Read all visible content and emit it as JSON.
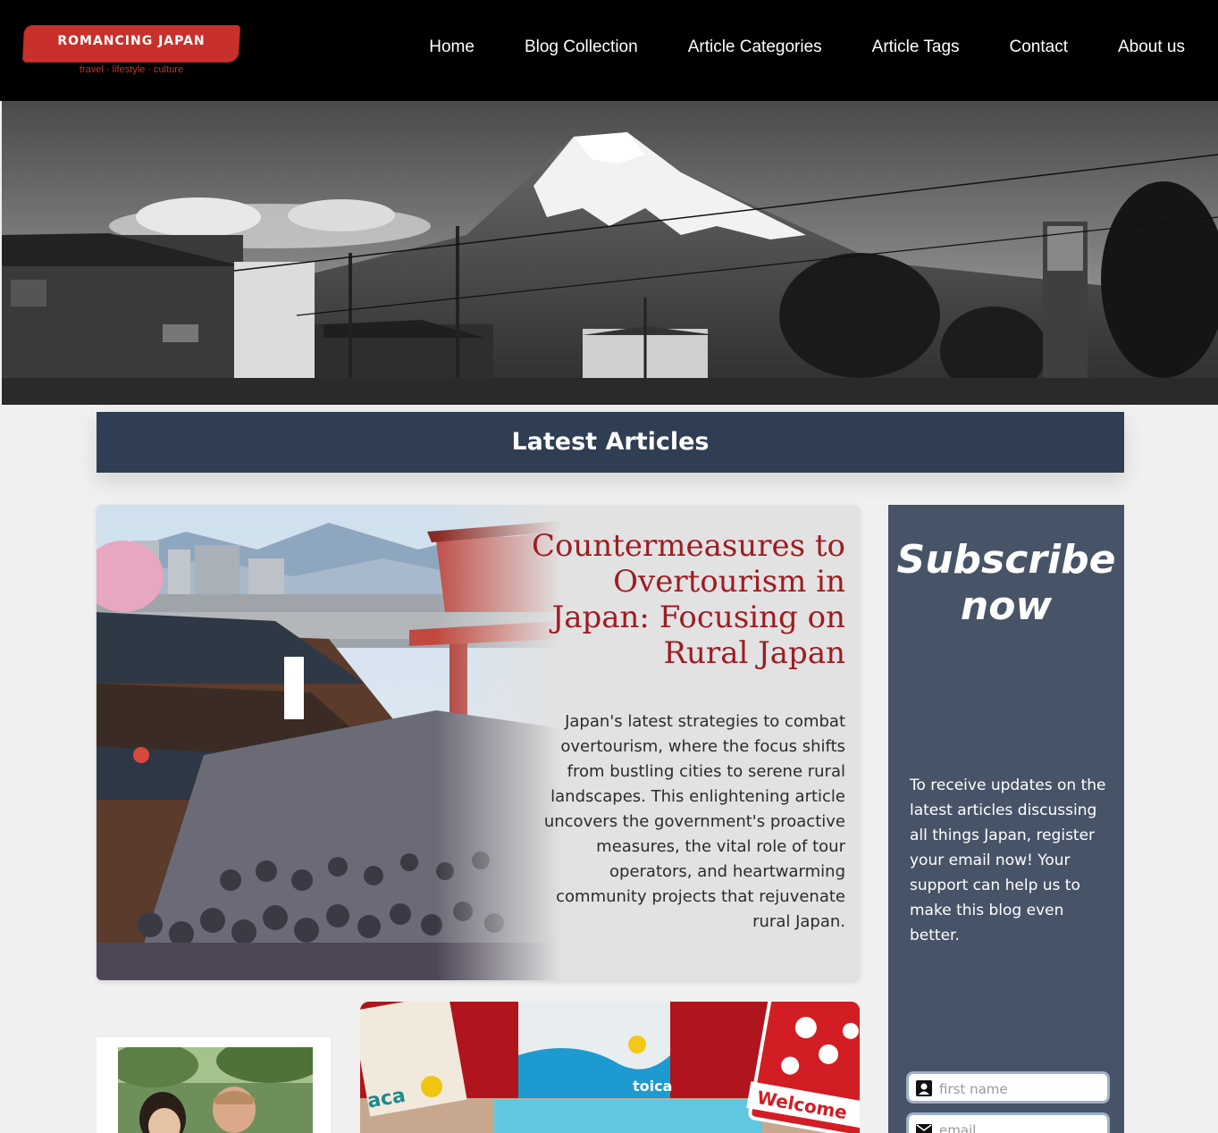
{
  "brand": {
    "name": "ROMANCING JAPAN",
    "tagline": "travel · lifestyle · culture",
    "accent_color": "#c9302c"
  },
  "nav": {
    "items": [
      {
        "label": "Home"
      },
      {
        "label": "Blog Collection"
      },
      {
        "label": "Article Categories"
      },
      {
        "label": "Article Tags"
      },
      {
        "label": "Contact"
      },
      {
        "label": "About us"
      }
    ]
  },
  "section": {
    "title": "Latest Articles",
    "bar_color": "#2f3e52"
  },
  "featured": {
    "title": "Countermeasures to Overtourism in Japan: Focusing on Rural Japan",
    "excerpt": "Japan's latest strategies to combat overtourism, where the focus shifts from bustling cities to serene rural landscapes. This enlightening article uncovers the government's proactive measures, the vital role of tour operators, and heartwarming community projects that rejuvenate rural Japan.",
    "title_color": "#9e1c22"
  },
  "subscribe": {
    "title": "Subscribe now",
    "text": "To receive updates on the latest articles discussing all things Japan, register your email now! Your support can help us to make this blog even better.",
    "fields": {
      "first_name_placeholder": "first name",
      "email_placeholder": "email"
    },
    "panel_color": "#475467"
  },
  "cards": {
    "card_b_sign": "Welcome",
    "card_b_text_1": "aca",
    "card_b_text_2": "toica"
  }
}
